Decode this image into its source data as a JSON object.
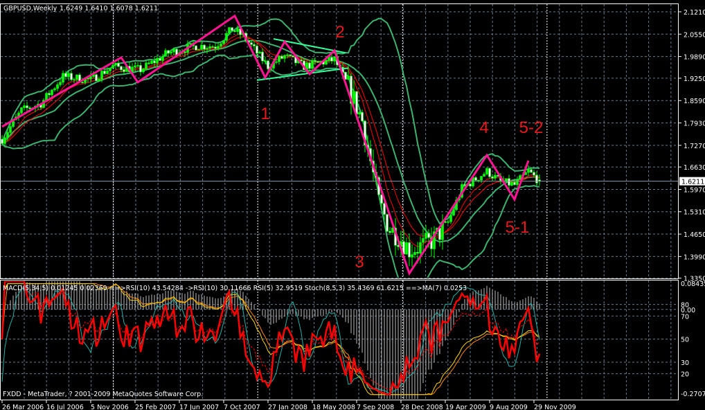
{
  "header": {
    "symbol": "GBPUSD,Weekly",
    "ohlc": "1.6249 1.6410 1.6078 1.6211"
  },
  "indicator_label": "MACD(5,34,5) 0.01245 0.02369 ==>RSI(10) 43.54284 ->RSI(10) 30.11666 RSI(5) 32.9519 Stoch(8,5,3) 35.4369 61.6215 ==>MA(7) 0.0253",
  "footer": "FXDD - MetaTrader, ? 2001-2009 MetaQuotes Software Corp.",
  "colors": {
    "background": "#000000",
    "grid": "#6b7b8c",
    "candle": "#00ff00",
    "bull_body": "#00ff00",
    "bear_body": "#ffffff",
    "bollinger": "#3cb371",
    "moving_average": "#ff0000",
    "zigzag": "#ff1493",
    "trendline": "#33ff99",
    "wave_label": "#e8191c",
    "macd": "#c0c0c0",
    "rsi": "#ff0000",
    "stoch": "#20b2aa",
    "ma_signal": "#ffd700",
    "ma_signal2": "#ff8c00"
  },
  "chart_data": {
    "type": "candlestick",
    "symbol": "GBPUSD",
    "timeframe": "Weekly",
    "ylim": [
      1.335,
      2.121
    ],
    "yticks": [
      "2.1210",
      "2.0550",
      "1.9890",
      "1.9250",
      "1.8590",
      "1.7930",
      "1.7270",
      "1.6630",
      "1.5970",
      "1.5310",
      "1.4650",
      "1.3990",
      "1.3350"
    ],
    "current_price": "1.6211",
    "last_bar": {
      "open": 1.6249,
      "high": 1.641,
      "low": 1.6078,
      "close": 1.6211
    },
    "xticks": [
      {
        "label": "26 Mar 2006",
        "date": "2006-03-26"
      },
      {
        "label": "16 Jul 2006",
        "date": "2006-07-16"
      },
      {
        "label": "5 Nov 2006",
        "date": "2006-11-05"
      },
      {
        "label": "25 Feb 2007",
        "date": "2007-02-25"
      },
      {
        "label": "17 Jun 2007",
        "date": "2007-06-17"
      },
      {
        "label": "7 Oct 2007",
        "date": "2007-10-07"
      },
      {
        "label": "27 Jan 2008",
        "date": "2008-01-27"
      },
      {
        "label": "18 May 2008",
        "date": "2008-05-18"
      },
      {
        "label": "7 Sep 2008",
        "date": "2008-09-07"
      },
      {
        "label": "28 Dec 2008",
        "date": "2008-12-28"
      },
      {
        "label": "19 Apr 2009",
        "date": "2009-04-19"
      },
      {
        "label": "9 Aug 2009",
        "date": "2009-08-09"
      },
      {
        "label": "29 Nov 2009",
        "date": "2009-11-29"
      }
    ],
    "price_path": [
      {
        "date": "2006-03-26",
        "price": 1.745
      },
      {
        "date": "2006-05-14",
        "price": 1.83
      },
      {
        "date": "2006-07-02",
        "price": 1.85
      },
      {
        "date": "2006-08-27",
        "price": 1.93
      },
      {
        "date": "2006-11-05",
        "price": 1.92
      },
      {
        "date": "2006-12-31",
        "price": 1.96
      },
      {
        "date": "2007-03-11",
        "price": 1.95
      },
      {
        "date": "2007-05-20",
        "price": 2.0
      },
      {
        "date": "2007-07-29",
        "price": 2.02
      },
      {
        "date": "2007-09-16",
        "price": 2.02
      },
      {
        "date": "2007-10-28",
        "price": 2.07
      },
      {
        "date": "2007-11-25",
        "price": 2.05
      },
      {
        "date": "2008-01-27",
        "price": 1.96
      },
      {
        "date": "2008-03-09",
        "price": 1.99
      },
      {
        "date": "2008-04-27",
        "price": 1.96
      },
      {
        "date": "2008-07-13",
        "price": 1.98
      },
      {
        "date": "2008-08-17",
        "price": 1.9
      },
      {
        "date": "2008-09-21",
        "price": 1.8
      },
      {
        "date": "2008-11-02",
        "price": 1.56
      },
      {
        "date": "2008-11-30",
        "price": 1.48
      },
      {
        "date": "2008-12-21",
        "price": 1.46
      },
      {
        "date": "2009-01-18",
        "price": 1.42
      },
      {
        "date": "2009-02-22",
        "price": 1.43
      },
      {
        "date": "2009-03-22",
        "price": 1.45
      },
      {
        "date": "2009-04-26",
        "price": 1.5
      },
      {
        "date": "2009-05-31",
        "price": 1.6
      },
      {
        "date": "2009-08-02",
        "price": 1.65
      },
      {
        "date": "2009-09-06",
        "price": 1.62
      },
      {
        "date": "2009-10-11",
        "price": 1.61
      },
      {
        "date": "2009-11-15",
        "price": 1.65
      },
      {
        "date": "2009-12-13",
        "price": 1.6211
      }
    ],
    "zigzag": [
      {
        "date": "2006-03-26",
        "price": 1.782
      },
      {
        "date": "2007-01-21",
        "price": 1.986
      },
      {
        "date": "2007-03-04",
        "price": 1.913
      },
      {
        "date": "2007-11-04",
        "price": 2.109
      },
      {
        "date": "2008-01-20",
        "price": 1.927
      },
      {
        "date": "2008-03-09",
        "price": 2.033
      },
      {
        "date": "2008-05-11",
        "price": 1.937
      },
      {
        "date": "2008-07-13",
        "price": 2.007
      },
      {
        "date": "2009-01-18",
        "price": 1.349
      },
      {
        "date": "2009-08-02",
        "price": 1.698
      },
      {
        "date": "2009-10-11",
        "price": 1.567
      },
      {
        "date": "2009-11-15",
        "price": 1.682
      }
    ],
    "trendlines": [
      {
        "from": {
          "date": "2008-02-10",
          "price": 2.041
        },
        "to": {
          "date": "2008-08-10",
          "price": 2.0
        }
      },
      {
        "from": {
          "date": "2007-12-30",
          "price": 1.919
        },
        "to": {
          "date": "2008-08-17",
          "price": 1.955
        }
      }
    ],
    "wave_labels": [
      {
        "text": "1",
        "date": "2008-01-20",
        "price": 1.823
      },
      {
        "text": "2",
        "date": "2008-07-27",
        "price": 2.064
      },
      {
        "text": "3",
        "date": "2008-09-14",
        "price": 1.385
      },
      {
        "text": "4",
        "date": "2009-07-26",
        "price": 1.782
      },
      {
        "text": "5-2",
        "date": "2009-11-22",
        "price": 1.782
      },
      {
        "text": "5-1",
        "date": "2009-10-18",
        "price": 1.488
      }
    ],
    "bollinger": {
      "period": 20,
      "deviations": 2
    },
    "indicator": {
      "macd_range": [
        -0.27075,
        0.08435
      ],
      "macd_ticks": [
        "0.08435",
        "0.00",
        "-0.27075"
      ],
      "levels": [
        80,
        70,
        50,
        30,
        20
      ]
    }
  }
}
